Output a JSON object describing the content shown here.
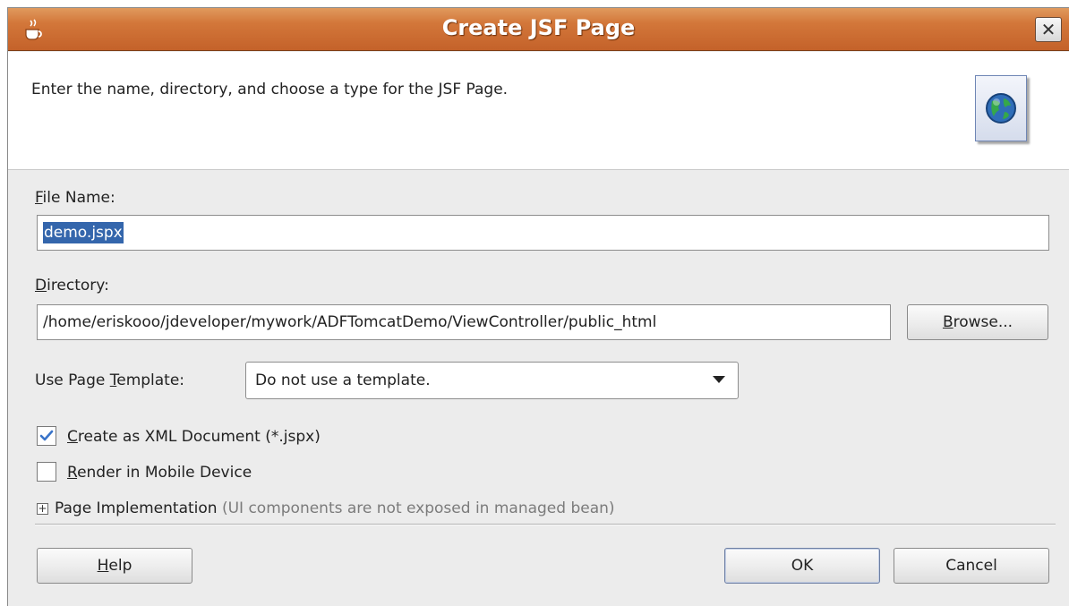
{
  "window": {
    "title": "Create JSF Page",
    "close_glyph": "✕"
  },
  "header": {
    "description": "Enter the name, directory, and choose a type for the JSF Page.",
    "icon": "globe-page-icon"
  },
  "file_name": {
    "label_mnemonic": "F",
    "label_rest": "ile Name:",
    "value": "demo.jspx"
  },
  "directory": {
    "label_mnemonic": "D",
    "label_rest": "irectory:",
    "value": "/home/eriskooo/jdeveloper/mywork/ADFTomcatDemo/ViewController/public_html",
    "browse_mnemonic": "B",
    "browse_rest": "rowse..."
  },
  "template": {
    "label_prefix": "Use Page ",
    "label_mnemonic": "T",
    "label_rest": "emplate:",
    "selected": "Do not use a template."
  },
  "options": {
    "xml_doc": {
      "mnemonic": "C",
      "rest": "reate as XML Document (*.jspx)",
      "checked": true
    },
    "mobile": {
      "mnemonic": "R",
      "rest": "ender in Mobile Device",
      "checked": false
    }
  },
  "page_implementation": {
    "label": "Page Implementation",
    "note": "(UI components are not exposed in managed bean)",
    "expander": "+"
  },
  "buttons": {
    "help_mnemonic": "H",
    "help_rest": "elp",
    "ok": "OK",
    "cancel": "Cancel"
  },
  "colors": {
    "titlebar": "#d3773a",
    "selection": "#3466ac",
    "check": "#3a74c9"
  }
}
